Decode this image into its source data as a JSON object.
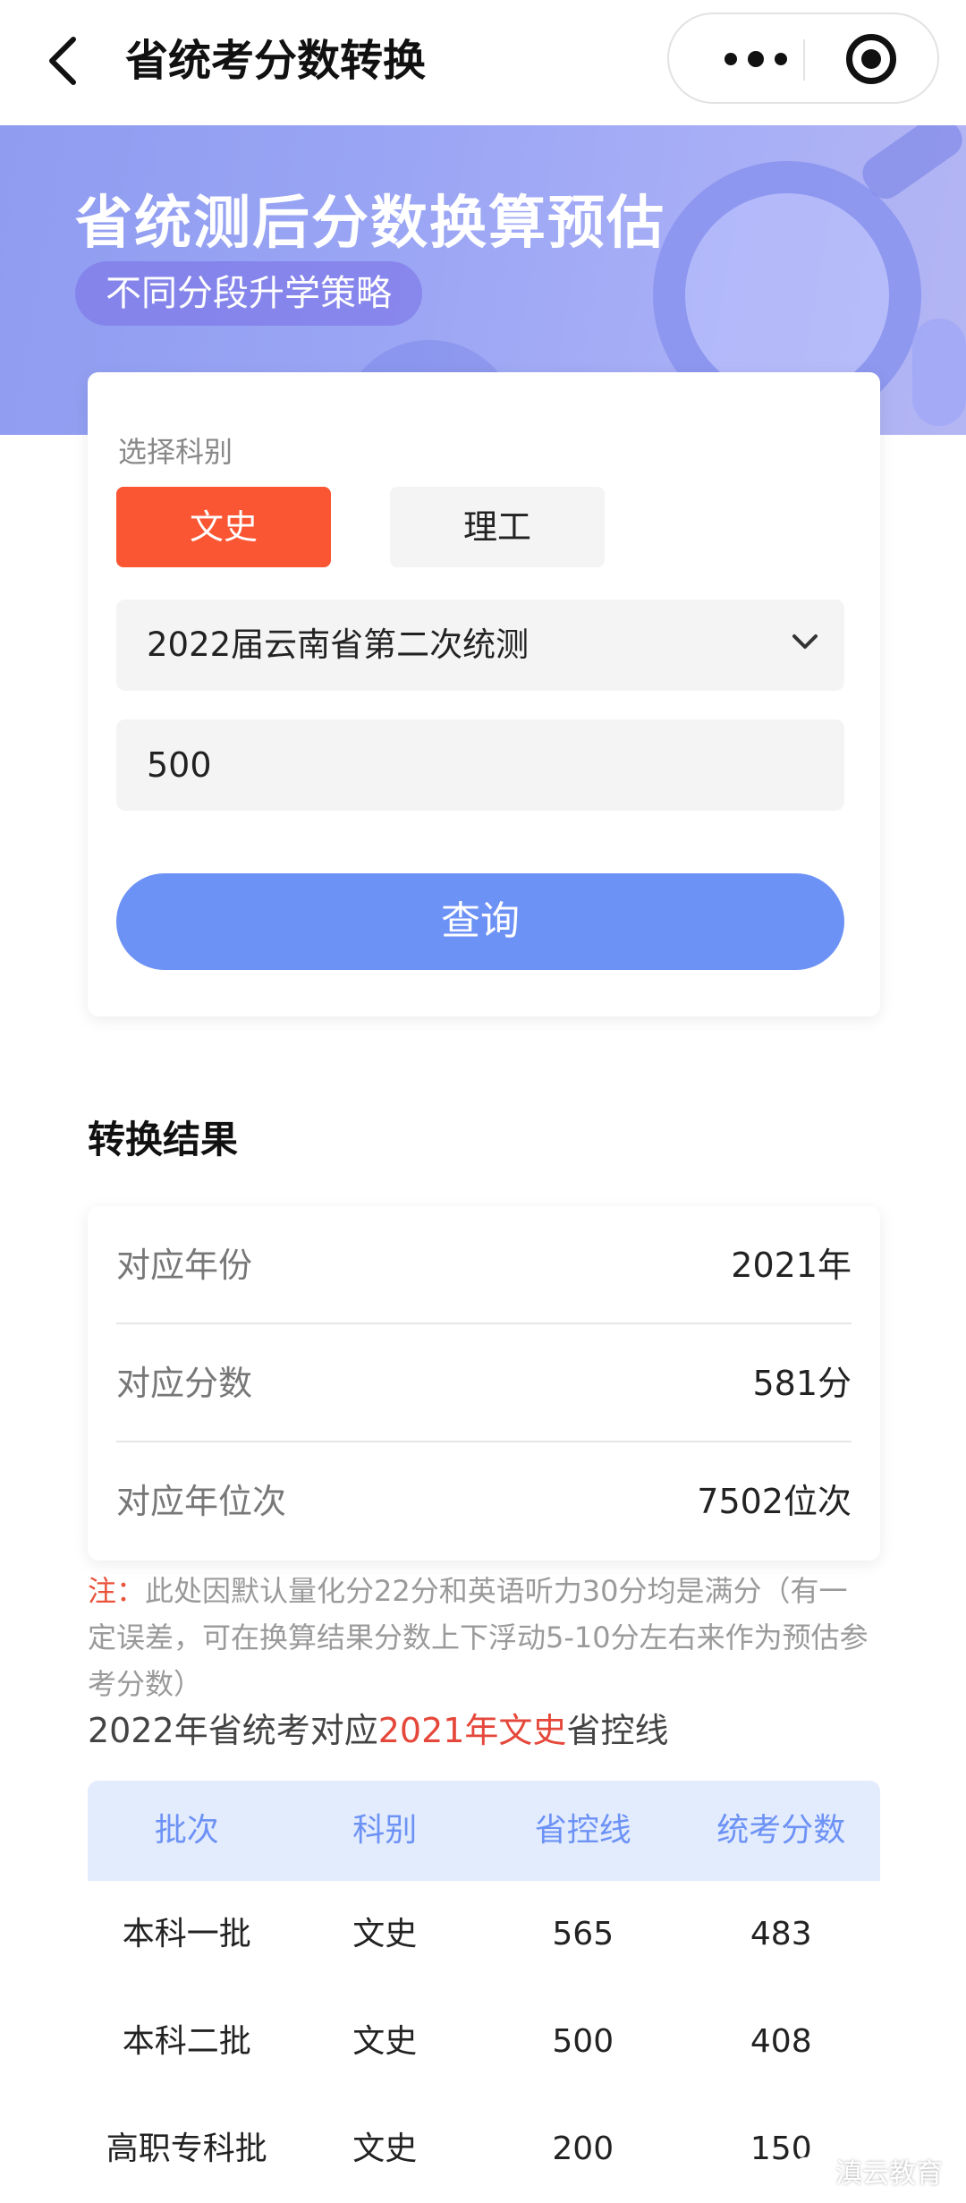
{
  "navbar": {
    "title": "省统考分数转换"
  },
  "banner": {
    "title": "省统测后分数换算预估",
    "tag": "不同分段升学策略"
  },
  "form": {
    "label": "选择科别",
    "subjects": [
      "文史",
      "理工"
    ],
    "selected_subject": "文史",
    "exam_select": "2022届云南省第二次统测",
    "score_value": "500",
    "query_label": "查询"
  },
  "result": {
    "title": "转换结果",
    "rows": [
      {
        "key": "对应年份",
        "value": "2021年"
      },
      {
        "key": "对应分数",
        "value": "581分"
      },
      {
        "key": "对应年位次",
        "value": "7502位次"
      }
    ]
  },
  "note": {
    "label": "注：",
    "text": "此处因默认量化分22分和英语听力30分均是满分（有一定误差，可在换算结果分数上下浮动5-10分左右来作为预估参考分数）"
  },
  "subtitle": {
    "prefix": "2022年省统考对应",
    "highlight": "2021年文史",
    "suffix": "省控线"
  },
  "table": {
    "headers": [
      "批次",
      "科别",
      "省控线",
      "统考分数"
    ],
    "rows": [
      [
        "本科一批",
        "文史",
        "565",
        "483"
      ],
      [
        "本科二批",
        "文史",
        "500",
        "408"
      ],
      [
        "高职专科批",
        "文史",
        "200",
        "150"
      ]
    ]
  },
  "watermark": {
    "text": "滇云教育"
  },
  "colors": {
    "accent": "#6d92f6",
    "selected": "#fa5633",
    "highlight": "#e5473a"
  }
}
